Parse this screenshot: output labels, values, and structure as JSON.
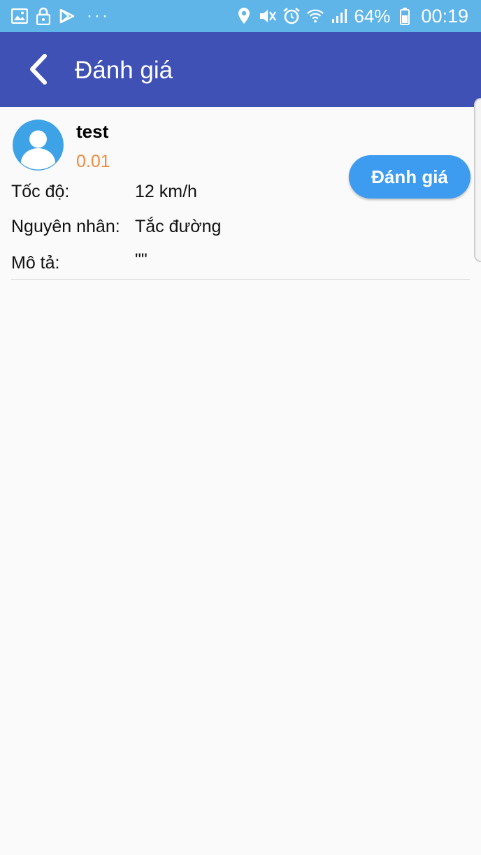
{
  "status_bar": {
    "left_icons": [
      "image-icon",
      "lock-icon",
      "play-store-icon"
    ],
    "more": "···",
    "right_icons": [
      "location-icon",
      "mute-icon",
      "alarm-icon",
      "wifi-icon",
      "signal-icon"
    ],
    "battery": "64%",
    "time": "00:19"
  },
  "app_bar": {
    "back_icon": "back-arrow-icon",
    "title": "Đánh giá"
  },
  "review": {
    "avatar_icon": "user-avatar-icon",
    "name": "test",
    "score": "0.01",
    "rate_button": "Đánh giá",
    "fields": [
      {
        "label": "Tốc độ:",
        "value": "12 km/h"
      },
      {
        "label": "Nguyên nhân:",
        "value": "Tắc đường"
      },
      {
        "label": "Mô tả:",
        "value": "\"\""
      }
    ]
  },
  "colors": {
    "status_bar": "#5fb4e8",
    "app_bar": "#3f51b5",
    "score": "#f08a3c",
    "button": "#3d9bf0"
  }
}
